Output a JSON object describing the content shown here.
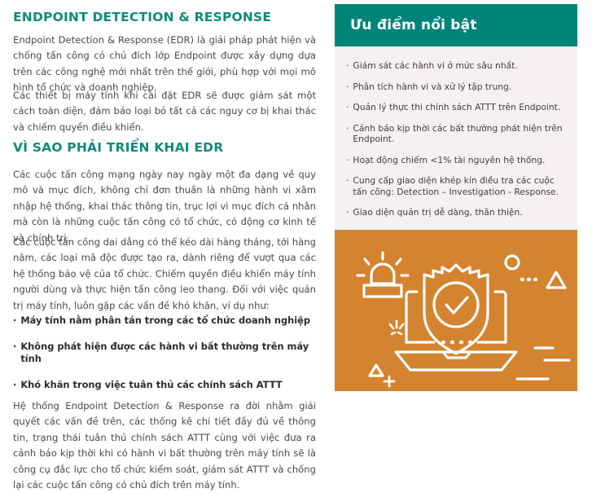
{
  "colors": {
    "heading_teal": "#108a7c",
    "panel_header_teal": "#00847a",
    "panel_body_cream": "#f5f1f0",
    "illustration_orange": "#d4832f",
    "body_text": "#4a4a4a"
  },
  "left": {
    "heading_1": "ENDPOINT DETECTION & RESPONSE",
    "para_1": "Endpoint Detection & Response (EDR) là giải pháp phát hiện và chống tấn công có chủ đích lớp Endpoint được xây dựng dựa trên các công nghệ mới nhất trên thế giới, phù hợp với mọi mô hình tổ chức và doanh nghiệp.",
    "para_2": "Các thiết bị máy tính khi cài đặt EDR sẽ được giám sát một cách toàn diện, đảm bảo loại bỏ tất cả các nguy cơ bị khai thác và chiếm quyền điều khiển.",
    "heading_2": "VÌ SAO PHẢI TRIỂN KHAI EDR",
    "para_3": "Các cuộc tấn công mạng ngày nay ngày một đa dạng về quy mô và mục đích, không chỉ đơn thuần là những hành vi xâm nhập hệ thống, khai thác thông tin, trục lợi vì mục đích cá nhân mà còn là những cuộc tấn công có tổ chức, có động cơ kinh tế và chính trị.",
    "para_4": "Các cuộc tấn công dai dẳng có thể kéo dài hàng tháng, tới hàng năm, các loại mã độc được tạo ra, dành riêng để vượt qua các hệ thống bảo vệ của tổ chức. Chiếm quyền điều khiển máy tính người dùng và thực hiện tấn công leo thang. Đối với việc quản trị máy tính, luôn gặp các vấn đề khó khăn, ví dụ như:",
    "bullet_marker": "·",
    "bullets": [
      "Máy tính nằm phân tán trong các tổ chức doanh nghiệp",
      "Không phát hiện được các hành vi bất thường trên máy tính",
      "Khó khăn trong việc tuân thủ các chính sách ATTT"
    ],
    "para_5": "Hệ thống Endpoint Detection & Response ra đời nhằm giải quyết các vấn đề trên, các thống kê chi tiết đầy đủ về thông tin, trạng thái tuân thủ chính sách ATTT cùng với việc đưa ra cảnh báo kịp thời khi có hành vi bất thường trên máy tính sẽ là công cụ đắc lực cho tổ chức kiểm soát, giám sát ATTT và chống lại các cuộc tấn công có chủ đích trên máy tính."
  },
  "right": {
    "header_title": "Ưu điểm nổi bật",
    "bullet_marker": "·",
    "features": [
      "Giám sát các hành vi ở mức sâu nhất.",
      "Phân tích hành vi và xử lý tập trung.",
      "Quản lý thực thi chính sách ATTT trên Endpoint.",
      "Cảnh báo kịp thời các bất thường phát hiện trên Endpoint.",
      "Hoạt động chiếm <1% tài nguyên hệ thống.",
      "Cung cấp giao diện khép kín điều tra các cuộc tấn công: Detection – Investigation - Response.",
      "Giao diện quản trị dễ dàng, thân thiện."
    ],
    "illustration": {
      "name": "endpoint-security-illustration",
      "elements": [
        "siren-icon",
        "laptop-icon",
        "shield-check-icon",
        "circle-shape",
        "dots-shape",
        "triangle-shape",
        "sparkle-shape",
        "plus-shape",
        "dash-shape"
      ]
    }
  }
}
